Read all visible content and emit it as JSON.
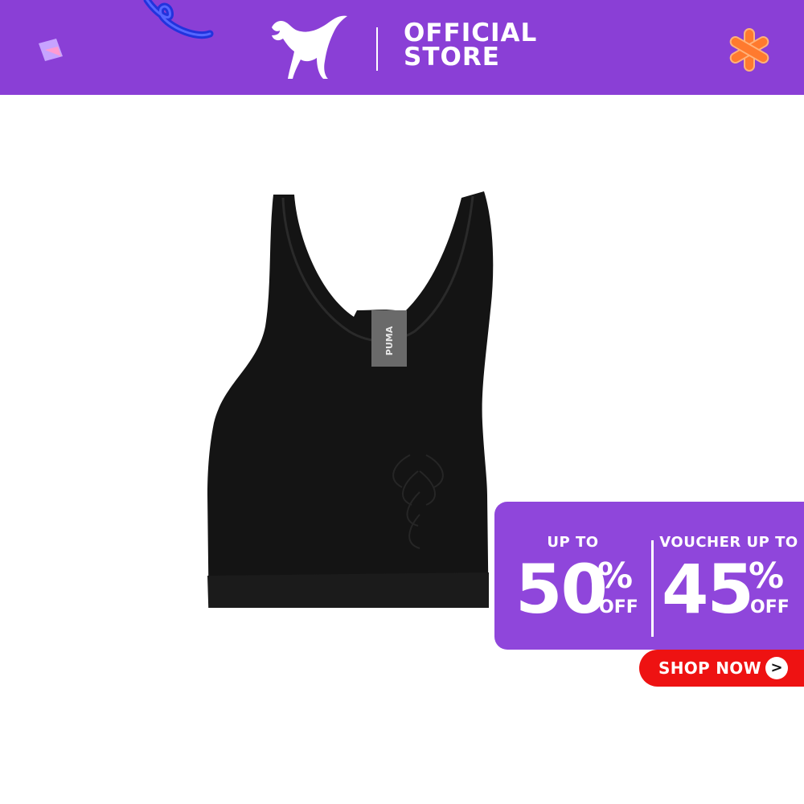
{
  "banner": {
    "brand_icon": "puma-cat-icon",
    "official_line1": "OFFICIAL",
    "official_line2": "STORE",
    "bg_color": "#8a3fd6"
  },
  "product": {
    "garment_logo_text": "PUMA",
    "color": "#121212"
  },
  "promo": {
    "left_label": "UP TO",
    "left_value": "50",
    "left_pct": "%",
    "left_off": "OFF",
    "right_label": "VOUCHER UP TO",
    "right_value": "45",
    "right_pct": "%",
    "right_off": "OFF",
    "bg_color": "#8f46db"
  },
  "cta": {
    "label": "SHOP NOW",
    "arrow": ">",
    "bg_color": "#ee1212"
  }
}
